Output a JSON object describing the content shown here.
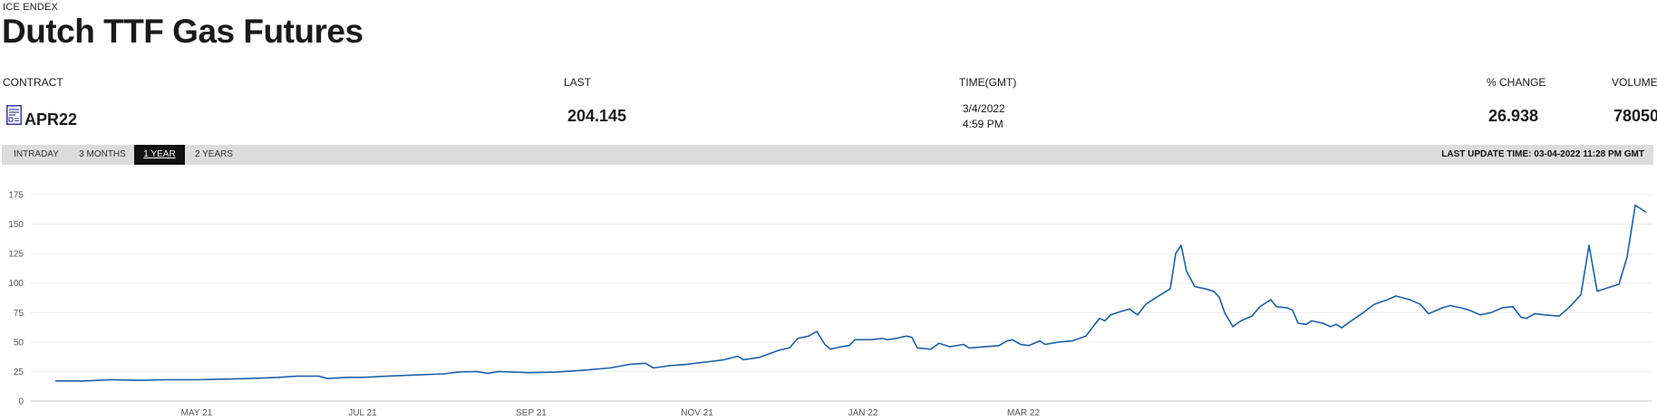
{
  "header": {
    "exchange": "ICE ENDEX",
    "title": "Dutch TTF Gas Futures"
  },
  "quote": {
    "columns": {
      "contract": "CONTRACT",
      "last": "LAST",
      "time": "TIME(GMT)",
      "pct_change": "% CHANGE",
      "volume": "VOLUME"
    },
    "contract": "APR22",
    "contract_icon": "document-chart-icon",
    "last": "204.145",
    "time_date": "3/4/2022",
    "time_clock": "4:59 PM",
    "pct_change": "26.938",
    "volume": "78050"
  },
  "range_tabs": {
    "tabs": [
      "INTRADAY",
      "3 MONTHS",
      "1 YEAR",
      "2 YEARS"
    ],
    "active": "1 YEAR"
  },
  "last_update": "LAST UPDATE TIME: 03-04-2022 11:28 PM GMT",
  "colors": {
    "line": "#1f5fa8",
    "tab_bar": "#dcdcdc",
    "active_tab": "#111111",
    "icon": "#3a3aa8"
  },
  "chart_data": {
    "type": "line",
    "title": "",
    "xlabel": "",
    "ylabel": "",
    "ylim": [
      0,
      175
    ],
    "yticks": [
      "0",
      "25",
      "50",
      "75",
      "100",
      "125",
      "150",
      "175"
    ],
    "xticks": [
      {
        "label": "MAY 21",
        "date": "2021-05-01"
      },
      {
        "label": "JUL 21",
        "date": "2021-07-01"
      },
      {
        "label": "SEP 21",
        "date": "2021-09-01"
      },
      {
        "label": "NOV 21",
        "date": "2021-11-01"
      },
      {
        "label": "JAN 22",
        "date": "2022-01-01"
      },
      {
        "label": "MAR 22",
        "date": "2022-03-01"
      }
    ],
    "grid": true,
    "series": [
      {
        "points": [
          [
            "2021-03-10",
            17
          ],
          [
            "2021-03-20",
            17
          ],
          [
            "2021-03-31",
            18
          ],
          [
            "2021-04-10",
            17.5
          ],
          [
            "2021-04-20",
            18
          ],
          [
            "2021-05-01",
            18
          ],
          [
            "2021-05-10",
            18.5
          ],
          [
            "2021-05-20",
            19
          ],
          [
            "2021-05-31",
            20
          ],
          [
            "2021-06-07",
            21
          ],
          [
            "2021-06-15",
            21
          ],
          [
            "2021-06-18",
            19
          ],
          [
            "2021-06-25",
            20
          ],
          [
            "2021-07-01",
            20
          ],
          [
            "2021-07-10",
            21
          ],
          [
            "2021-07-20",
            22
          ],
          [
            "2021-07-31",
            23
          ],
          [
            "2021-08-05",
            24.5
          ],
          [
            "2021-08-12",
            25
          ],
          [
            "2021-08-16",
            23.5
          ],
          [
            "2021-08-20",
            25
          ],
          [
            "2021-08-31",
            24
          ],
          [
            "2021-09-10",
            24.5
          ],
          [
            "2021-09-20",
            26
          ],
          [
            "2021-09-30",
            28
          ],
          [
            "2021-10-07",
            31
          ],
          [
            "2021-10-13",
            32
          ],
          [
            "2021-10-16",
            28
          ],
          [
            "2021-10-22",
            30
          ],
          [
            "2021-10-28",
            31
          ],
          [
            "2021-11-04",
            33
          ],
          [
            "2021-11-11",
            35
          ],
          [
            "2021-11-16",
            38
          ],
          [
            "2021-11-18",
            35
          ],
          [
            "2021-11-24",
            37
          ],
          [
            "2021-12-01",
            43
          ],
          [
            "2021-12-05",
            45
          ],
          [
            "2021-12-08",
            53
          ],
          [
            "2021-12-12",
            55
          ],
          [
            "2021-12-15",
            59
          ],
          [
            "2021-12-18",
            48
          ],
          [
            "2021-12-20",
            44
          ],
          [
            "2021-12-24",
            46
          ],
          [
            "2021-12-27",
            47
          ],
          [
            "2021-12-29",
            52
          ],
          [
            "2022-01-04",
            52
          ],
          [
            "2022-01-08",
            53
          ],
          [
            "2022-01-10",
            52
          ],
          [
            "2022-01-13",
            53
          ],
          [
            "2022-01-17",
            55
          ],
          [
            "2022-01-19",
            54
          ],
          [
            "2022-01-21",
            45
          ],
          [
            "2022-01-26",
            44
          ],
          [
            "2022-01-29",
            49
          ],
          [
            "2022-02-02",
            46
          ],
          [
            "2022-02-07",
            48
          ],
          [
            "2022-02-09",
            45
          ],
          [
            "2022-02-15",
            46
          ],
          [
            "2022-02-20",
            47
          ],
          [
            "2022-02-23",
            51
          ],
          [
            "2022-02-25",
            52
          ],
          [
            "2022-02-28",
            48
          ],
          [
            "2022-03-03",
            47
          ],
          [
            "2022-03-07",
            51
          ],
          [
            "2022-03-09",
            48
          ],
          [
            "2022-03-14",
            50
          ],
          [
            "2022-03-19",
            51
          ],
          [
            "2022-03-24",
            55
          ],
          [
            "2022-03-29",
            70
          ],
          [
            "2022-03-31",
            68
          ],
          [
            "2022-04-02",
            73
          ],
          [
            "2022-04-06",
            76
          ],
          [
            "2022-04-09",
            78
          ],
          [
            "2022-04-12",
            73
          ],
          [
            "2022-04-15",
            82
          ],
          [
            "2022-04-19",
            88
          ],
          [
            "2022-04-24",
            95
          ],
          [
            "2022-04-26",
            125
          ],
          [
            "2022-04-28",
            132
          ],
          [
            "2022-04-30",
            110
          ],
          [
            "2022-05-03",
            97
          ],
          [
            "2022-05-07",
            95
          ],
          [
            "2022-05-10",
            93
          ],
          [
            "2022-05-12",
            88
          ],
          [
            "2022-05-14",
            75
          ],
          [
            "2022-05-17",
            63
          ],
          [
            "2022-05-20",
            68
          ],
          [
            "2022-05-24",
            72
          ],
          [
            "2022-05-27",
            80
          ],
          [
            "2022-05-31",
            86
          ],
          [
            "2022-06-02",
            80
          ],
          [
            "2022-06-06",
            79
          ],
          [
            "2022-06-08",
            77
          ],
          [
            "2022-06-10",
            66
          ],
          [
            "2022-06-13",
            65
          ],
          [
            "2022-06-15",
            68
          ],
          [
            "2022-06-19",
            66
          ],
          [
            "2022-06-22",
            63
          ],
          [
            "2022-06-24",
            65
          ],
          [
            "2022-06-26",
            62
          ],
          [
            "2022-06-29",
            67
          ],
          [
            "2022-07-04",
            75
          ],
          [
            "2022-07-08",
            82
          ],
          [
            "2022-07-13",
            86
          ],
          [
            "2022-07-16",
            89
          ],
          [
            "2022-07-21",
            86
          ],
          [
            "2022-07-25",
            82
          ],
          [
            "2022-07-28",
            74
          ],
          [
            "2022-08-02",
            79
          ],
          [
            "2022-08-05",
            81
          ],
          [
            "2022-08-09",
            79
          ],
          [
            "2022-08-12",
            77
          ],
          [
            "2022-08-16",
            73
          ],
          [
            "2022-08-20",
            75
          ],
          [
            "2022-08-24",
            79
          ],
          [
            "2022-08-28",
            80
          ],
          [
            "2022-08-31",
            71
          ],
          [
            "2022-09-02",
            70
          ],
          [
            "2022-09-05",
            74
          ],
          [
            "2022-09-09",
            73
          ],
          [
            "2022-09-14",
            72
          ],
          [
            "2022-09-18",
            80
          ],
          [
            "2022-09-22",
            90
          ],
          [
            "2022-09-25",
            132
          ],
          [
            "2022-09-28",
            93
          ],
          [
            "2022-10-02",
            96
          ],
          [
            "2022-10-06",
            99
          ],
          [
            "2022-10-09",
            122
          ],
          [
            "2022-10-12",
            166
          ],
          [
            "2022-10-16",
            160
          ]
        ]
      }
    ]
  }
}
